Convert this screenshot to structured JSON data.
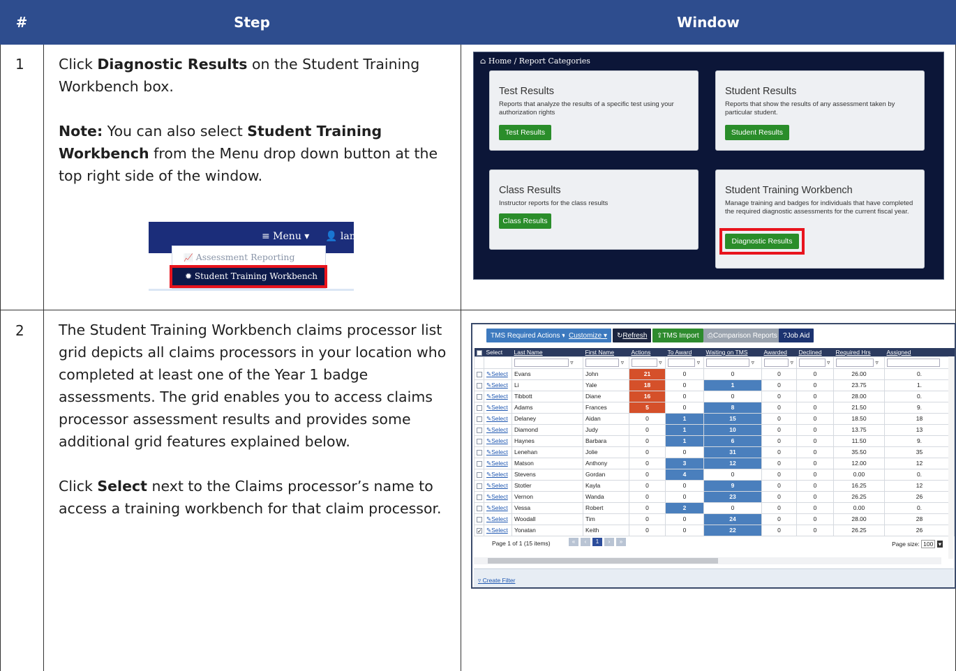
{
  "header": {
    "col_num": "#",
    "col_step": "Step",
    "col_window": "Window"
  },
  "rows": [
    {
      "num": "1",
      "step_para1_pre": "Click ",
      "step_para1_bold": "Diagnostic Results",
      "step_para1_post": " on the Student Training Workbench box.",
      "note_label": "Note:",
      "note_pre": " You can also select ",
      "note_bold": "Student Training Workbench",
      "note_post": " from the Menu drop down button at the top right side of the window."
    },
    {
      "num": "2",
      "step_para1": "The Student Training Workbench claims processor list grid depicts all claims processors in your location who completed at least one of the Year 1 badge assessments. The grid enables you to access claims processor assessment results and provides some additional grid features explained below.",
      "step_para2_pre": "Click ",
      "step_para2_bold": "Select",
      "step_para2_post": " next to the Claims processor’s name to access a training workbench for that claim processor."
    }
  ],
  "menu_snippet": {
    "menu_label": "≡ Menu ▾",
    "user_label": "👤 lamo",
    "item_reporting": "Assessment Reporting",
    "item_workbench": "Student Training Workbench"
  },
  "report_categories": {
    "breadcrumb_home": "Home",
    "breadcrumb_sep": "/",
    "breadcrumb_current": "Report Categories",
    "cards": [
      {
        "title": "Test Results",
        "desc": "Reports that analyze the results of a specific test using your authorization rights",
        "button": "Test Results"
      },
      {
        "title": "Student Results",
        "desc": "Reports that show the results of any assessment taken by particular student.",
        "button": "Student Results"
      },
      {
        "title": "Class Results",
        "desc": "Instructor reports for the class results",
        "button": "Class Results"
      },
      {
        "title": "Student Training Workbench",
        "desc": "Manage training and badges for individuals that have completed the required diagnostic assessments for the current fiscal year.",
        "button": "Diagnostic Results"
      }
    ]
  },
  "grid_window": {
    "toolbar": {
      "tms_required": "TMS Required Actions ▾",
      "customize": "Customize ▾",
      "refresh": "Refresh",
      "tms_import": "TMS Import",
      "comparison": "Comparison Reports",
      "job_aid": "Job Aid"
    },
    "columns": [
      "Select",
      "Last Name",
      "First Name",
      "Actions",
      "To Award",
      "Waiting on TMS",
      "Awarded",
      "Declined",
      "Required Hrs",
      "Assigned"
    ],
    "select_label": "Select",
    "rows": [
      {
        "last": "Evans",
        "first": "John",
        "actions": "21",
        "to_award": "0",
        "waiting": "0",
        "awarded": "0",
        "declined": "0",
        "req": "26.00",
        "assigned": "0.",
        "checked": false
      },
      {
        "last": "Li",
        "first": "Yale",
        "actions": "18",
        "to_award": "0",
        "waiting": "1",
        "awarded": "0",
        "declined": "0",
        "req": "23.75",
        "assigned": "1.",
        "checked": false
      },
      {
        "last": "Tibbott",
        "first": "Diane",
        "actions": "16",
        "to_award": "0",
        "waiting": "0",
        "awarded": "0",
        "declined": "0",
        "req": "28.00",
        "assigned": "0.",
        "checked": false
      },
      {
        "last": "Adams",
        "first": "Frances",
        "actions": "5",
        "to_award": "0",
        "waiting": "8",
        "awarded": "0",
        "declined": "0",
        "req": "21.50",
        "assigned": "9.",
        "checked": false
      },
      {
        "last": "Delaney",
        "first": "Aidan",
        "actions": "0",
        "to_award": "1",
        "waiting": "15",
        "awarded": "0",
        "declined": "0",
        "req": "18.50",
        "assigned": "18",
        "checked": false
      },
      {
        "last": "Diamond",
        "first": "Judy",
        "actions": "0",
        "to_award": "1",
        "waiting": "10",
        "awarded": "0",
        "declined": "0",
        "req": "13.75",
        "assigned": "13",
        "checked": false
      },
      {
        "last": "Haynes",
        "first": "Barbara",
        "actions": "0",
        "to_award": "1",
        "waiting": "6",
        "awarded": "0",
        "declined": "0",
        "req": "11.50",
        "assigned": "9.",
        "checked": false
      },
      {
        "last": "Lenehan",
        "first": "Jolie",
        "actions": "0",
        "to_award": "0",
        "waiting": "31",
        "awarded": "0",
        "declined": "0",
        "req": "35.50",
        "assigned": "35",
        "checked": false
      },
      {
        "last": "Matson",
        "first": "Anthony",
        "actions": "0",
        "to_award": "3",
        "waiting": "12",
        "awarded": "0",
        "declined": "0",
        "req": "12.00",
        "assigned": "12",
        "checked": false
      },
      {
        "last": "Stevens",
        "first": "Gordan",
        "actions": "0",
        "to_award": "4",
        "waiting": "0",
        "awarded": "0",
        "declined": "0",
        "req": "0.00",
        "assigned": "0.",
        "checked": false
      },
      {
        "last": "Stotler",
        "first": "Kayla",
        "actions": "0",
        "to_award": "0",
        "waiting": "9",
        "awarded": "0",
        "declined": "0",
        "req": "16.25",
        "assigned": "12",
        "checked": false
      },
      {
        "last": "Vernon",
        "first": "Wanda",
        "actions": "0",
        "to_award": "0",
        "waiting": "23",
        "awarded": "0",
        "declined": "0",
        "req": "26.25",
        "assigned": "26",
        "checked": false
      },
      {
        "last": "Vessa",
        "first": "Robert",
        "actions": "0",
        "to_award": "2",
        "waiting": "0",
        "awarded": "0",
        "declined": "0",
        "req": "0.00",
        "assigned": "0.",
        "checked": false
      },
      {
        "last": "Woodall",
        "first": "Tim",
        "actions": "0",
        "to_award": "0",
        "waiting": "24",
        "awarded": "0",
        "declined": "0",
        "req": "28.00",
        "assigned": "28",
        "checked": false
      },
      {
        "last": "Yonatan",
        "first": "Keith",
        "actions": "0",
        "to_award": "0",
        "waiting": "22",
        "awarded": "0",
        "declined": "0",
        "req": "26.25",
        "assigned": "26",
        "checked": true
      }
    ],
    "pager_info": "Page 1 of 1 (15 items)",
    "current_page": "1",
    "page_size_label": "Page size:",
    "page_size_value": "100",
    "create_filter": "Create Filter"
  }
}
